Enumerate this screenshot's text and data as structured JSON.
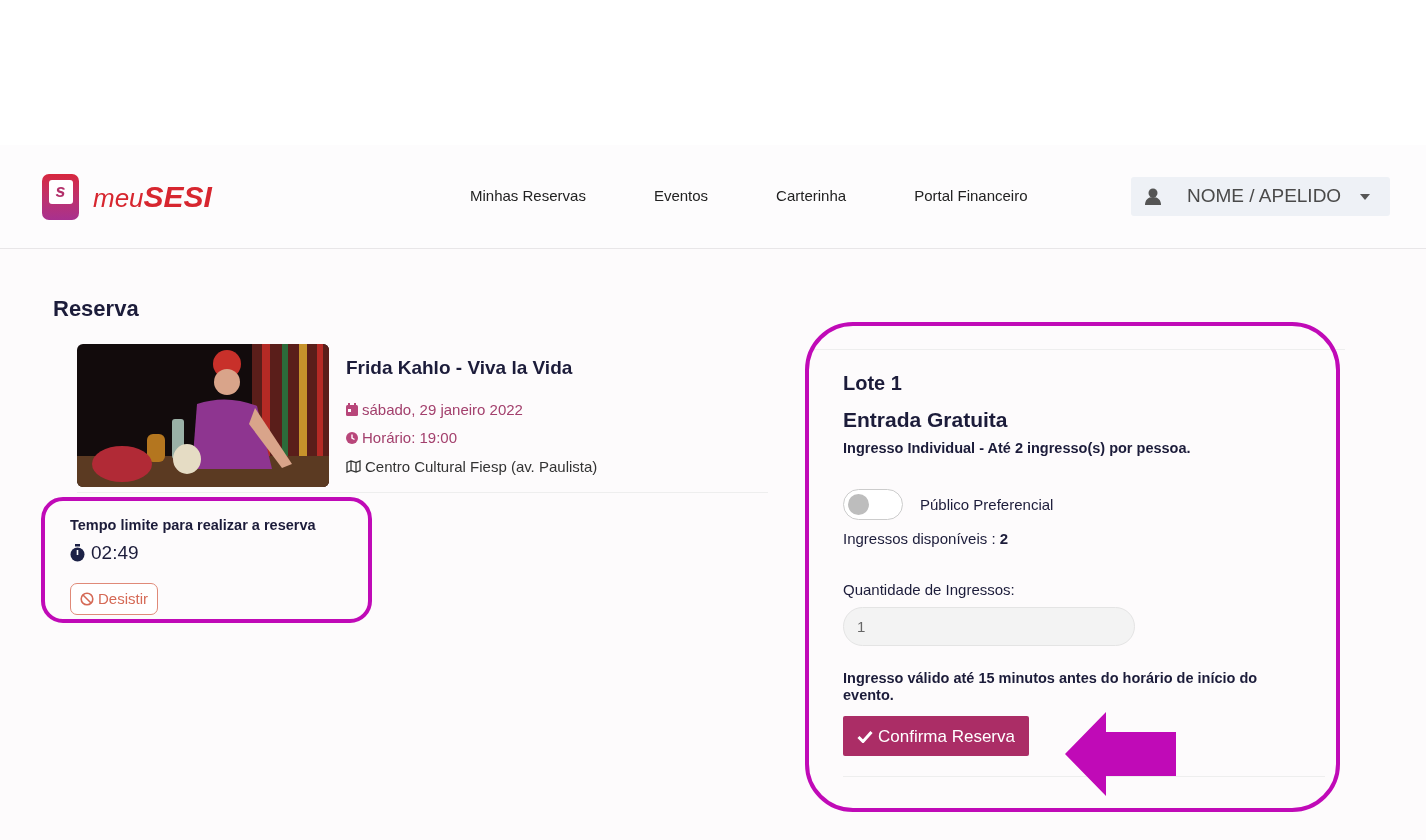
{
  "brand": {
    "mark": "s",
    "prefix": "meu",
    "name": "SESI"
  },
  "nav": [
    {
      "label": "Minhas Reservas"
    },
    {
      "label": "Eventos"
    },
    {
      "label": "Carterinha"
    },
    {
      "label": "Portal Financeiro"
    }
  ],
  "user_menu": {
    "label": "NOME / APELIDO"
  },
  "page_title": "Reserva",
  "event": {
    "title": "Frida Kahlo - Viva la Vida",
    "date": "sábado, 29 janeiro 2022",
    "time": "Horário: 19:00",
    "venue": "Centro Cultural Fiesp (av. Paulista)"
  },
  "timer": {
    "label": "Tempo limite para realizar a reserva",
    "value": "02:49",
    "cancel_button": "Desistir"
  },
  "ticket": {
    "lot": "Lote 1",
    "type": "Entrada Gratuita",
    "description": "Ingresso Individual - Até 2 ingresso(s) por pessoa.",
    "preferential": {
      "label": "Público Preferencial",
      "on": false
    },
    "available": "Ingressos disponíveis : **2**",
    "quantity": {
      "label": "Quantidade de Ingressos:",
      "value": "1"
    },
    "note": "Ingresso válido até 15 minutos antes do horário de início do evento.",
    "confirm_button": "Confirma Reserva"
  }
}
